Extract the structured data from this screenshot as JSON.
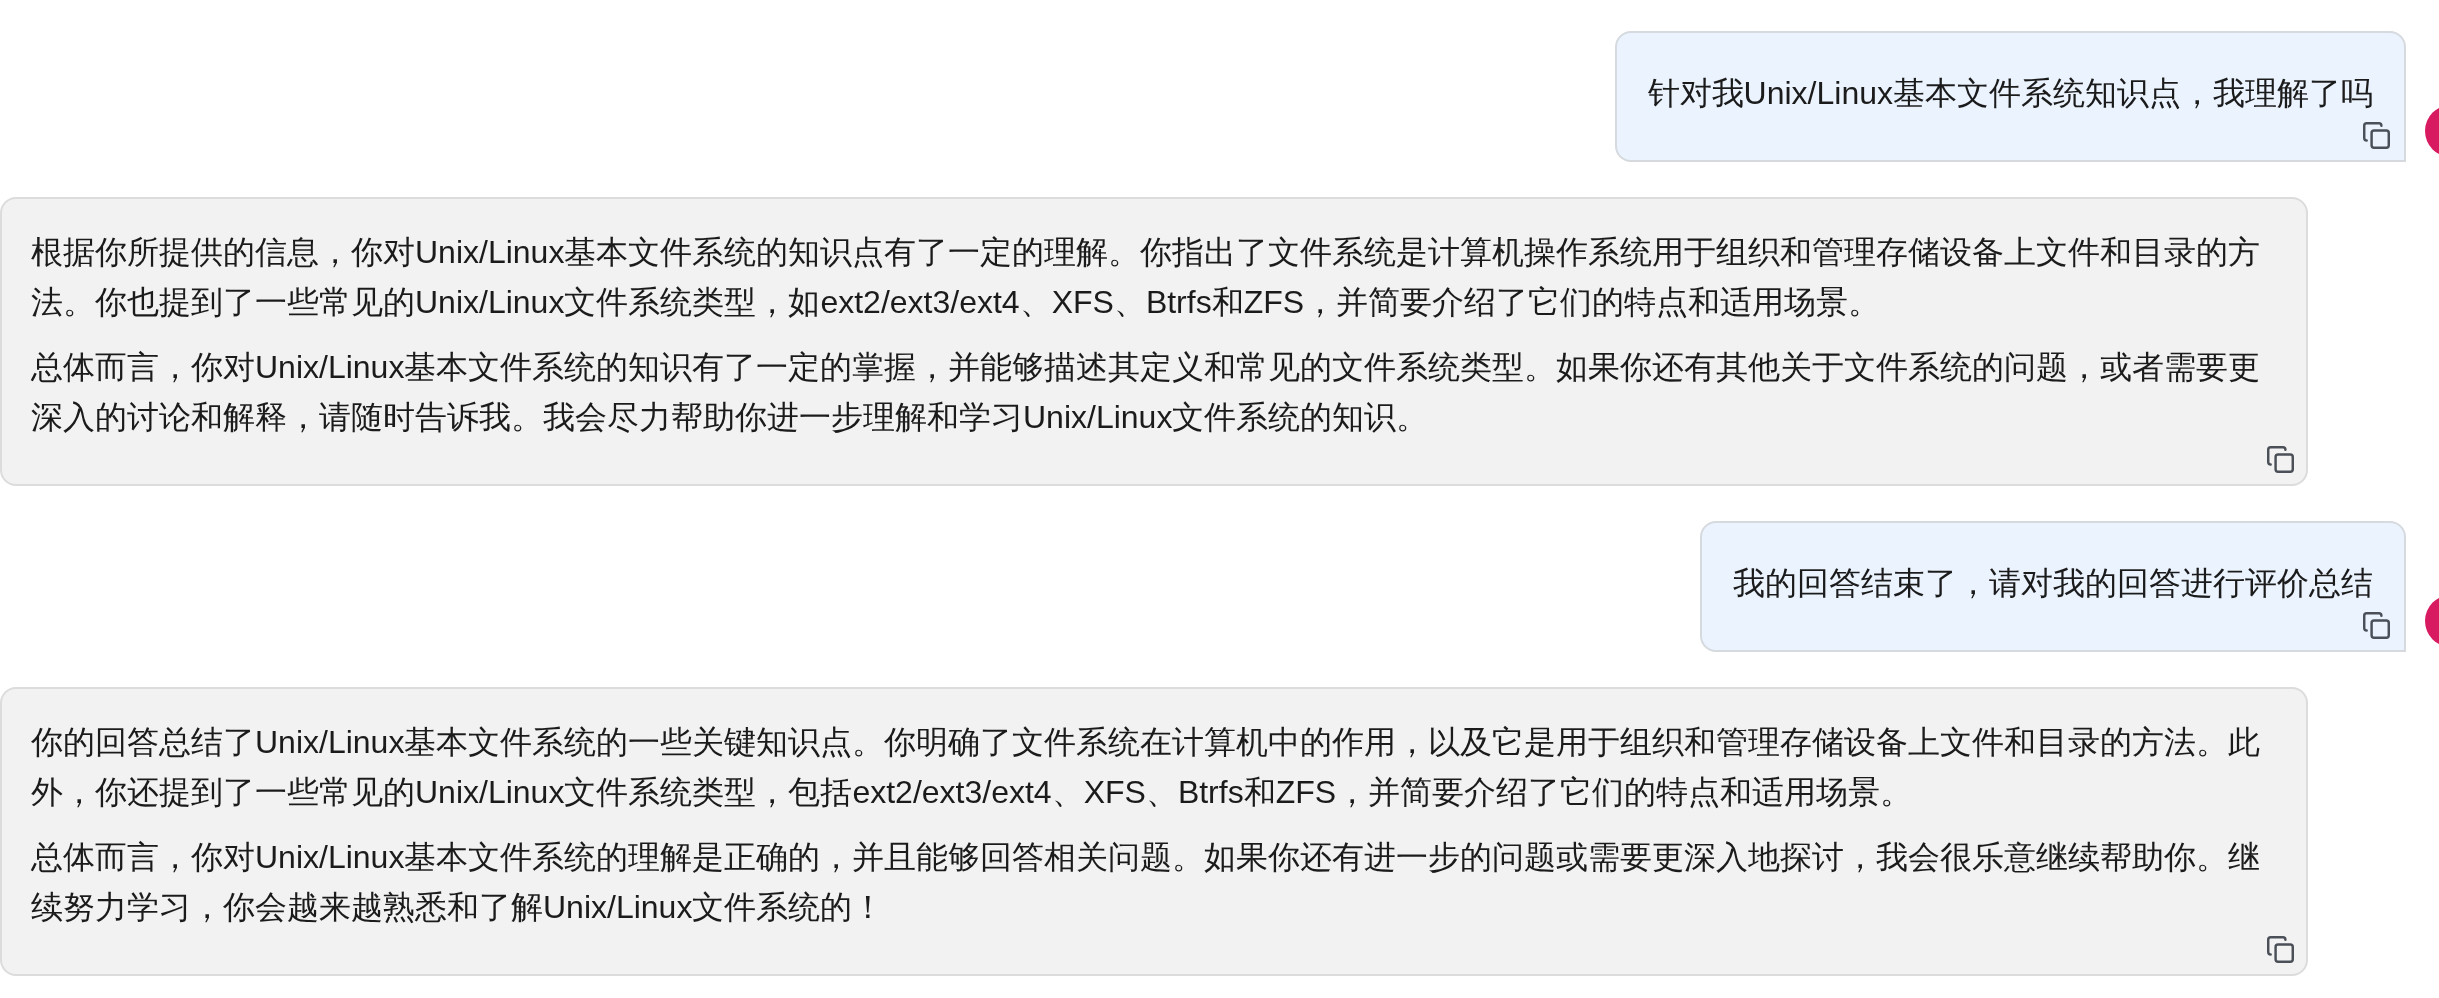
{
  "messages": [
    {
      "kind": "user",
      "paragraphs": [
        "针对我Unix/Linux基本文件系统知识点，我理解了吗"
      ]
    },
    {
      "kind": "assistant",
      "paragraphs": [
        "根据你所提供的信息，你对Unix/Linux基本文件系统的知识点有了一定的理解。你指出了文件系统是计算机操作系统用于组织和管理存储设备上文件和目录的方法。你也提到了一些常见的Unix/Linux文件系统类型，如ext2/ext3/ext4、XFS、Btrfs和ZFS，并简要介绍了它们的特点和适用场景。",
        "总体而言，你对Unix/Linux基本文件系统的知识有了一定的掌握，并能够描述其定义和常见的文件系统类型。如果你还有其他关于文件系统的问题，或者需要更深入的讨论和解释，请随时告诉我。我会尽力帮助你进一步理解和学习Unix/Linux文件系统的知识。"
      ]
    },
    {
      "kind": "user",
      "paragraphs": [
        "我的回答结束了，请对我的回答进行评价总结"
      ]
    },
    {
      "kind": "assistant",
      "paragraphs": [
        "你的回答总结了Unix/Linux基本文件系统的一些关键知识点。你明确了文件系统在计算机中的作用，以及它是用于组织和管理存储设备上文件和目录的方法。此外，你还提到了一些常见的Unix/Linux文件系统类型，包括ext2/ext3/ext4、XFS、Btrfs和ZFS，并简要介绍了它们的特点和适用场景。",
        "总体而言，你对Unix/Linux基本文件系统的理解是正确的，并且能够回答相关问题。如果你还有进一步的问题或需要更深入地探讨，我会很乐意继续帮助你。继续努力学习，你会越来越熟悉和了解Unix/Linux文件系统的！"
      ]
    }
  ]
}
